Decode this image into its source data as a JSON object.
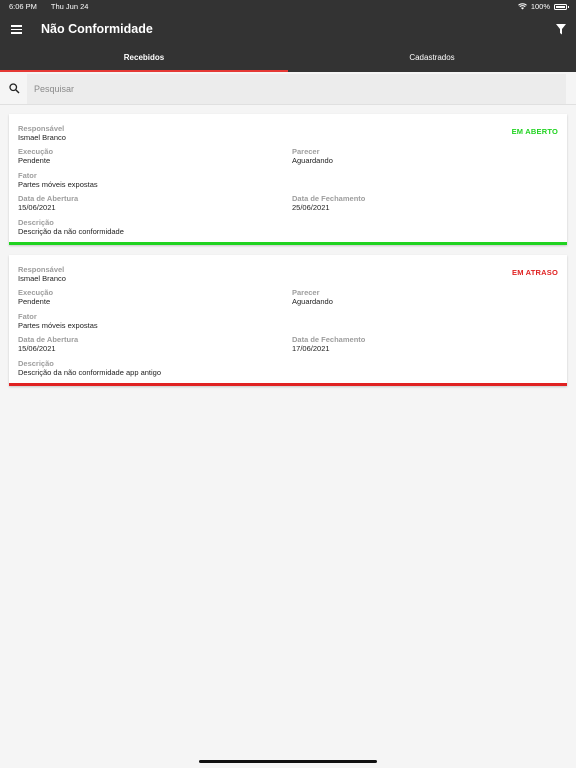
{
  "status_bar": {
    "time": "6:06 PM",
    "date": "Thu Jun 24",
    "battery": "100%"
  },
  "app_bar": {
    "title": "Não Conformidade"
  },
  "tabs": [
    {
      "label": "Recebidos",
      "active": true
    },
    {
      "label": "Cadastrados",
      "active": false
    }
  ],
  "search": {
    "placeholder": "Pesquisar",
    "value": ""
  },
  "cards": [
    {
      "status": "EM ABERTO",
      "status_color": "#21d321",
      "responsavel_label": "Responsável",
      "responsavel": "Ismael Branco",
      "execucao_label": "Execução",
      "execucao": "Pendente",
      "parecer_label": "Parecer",
      "parecer": "Aguardando",
      "fator_label": "Fator",
      "fator": "Partes móveis expostas",
      "abertura_label": "Data de Abertura",
      "abertura": "15/06/2021",
      "fechamento_label": "Data de Fechamento",
      "fechamento": "25/06/2021",
      "descricao_label": "Descrição",
      "descricao": "Descrição da não conformidade"
    },
    {
      "status": "EM ATRASO",
      "status_color": "#e02222",
      "responsavel_label": "Responsável",
      "responsavel": "Ismael Branco",
      "execucao_label": "Execução",
      "execucao": "Pendente",
      "parecer_label": "Parecer",
      "parecer": "Aguardando",
      "fator_label": "Fator",
      "fator": "Partes móveis expostas",
      "abertura_label": "Data de Abertura",
      "abertura": "15/06/2021",
      "fechamento_label": "Data de Fechamento",
      "fechamento": "17/06/2021",
      "descricao_label": "Descrição",
      "descricao": "Descrição da não conformidade app antigo"
    }
  ],
  "colors": {
    "header": "#333333",
    "tab_indicator": "#e53935",
    "background": "#f5f5f5"
  },
  "icons": {
    "menu": "menu-icon",
    "filter": "filter-icon",
    "search": "search-icon",
    "wifi": "wifi-icon",
    "battery": "battery-icon"
  }
}
